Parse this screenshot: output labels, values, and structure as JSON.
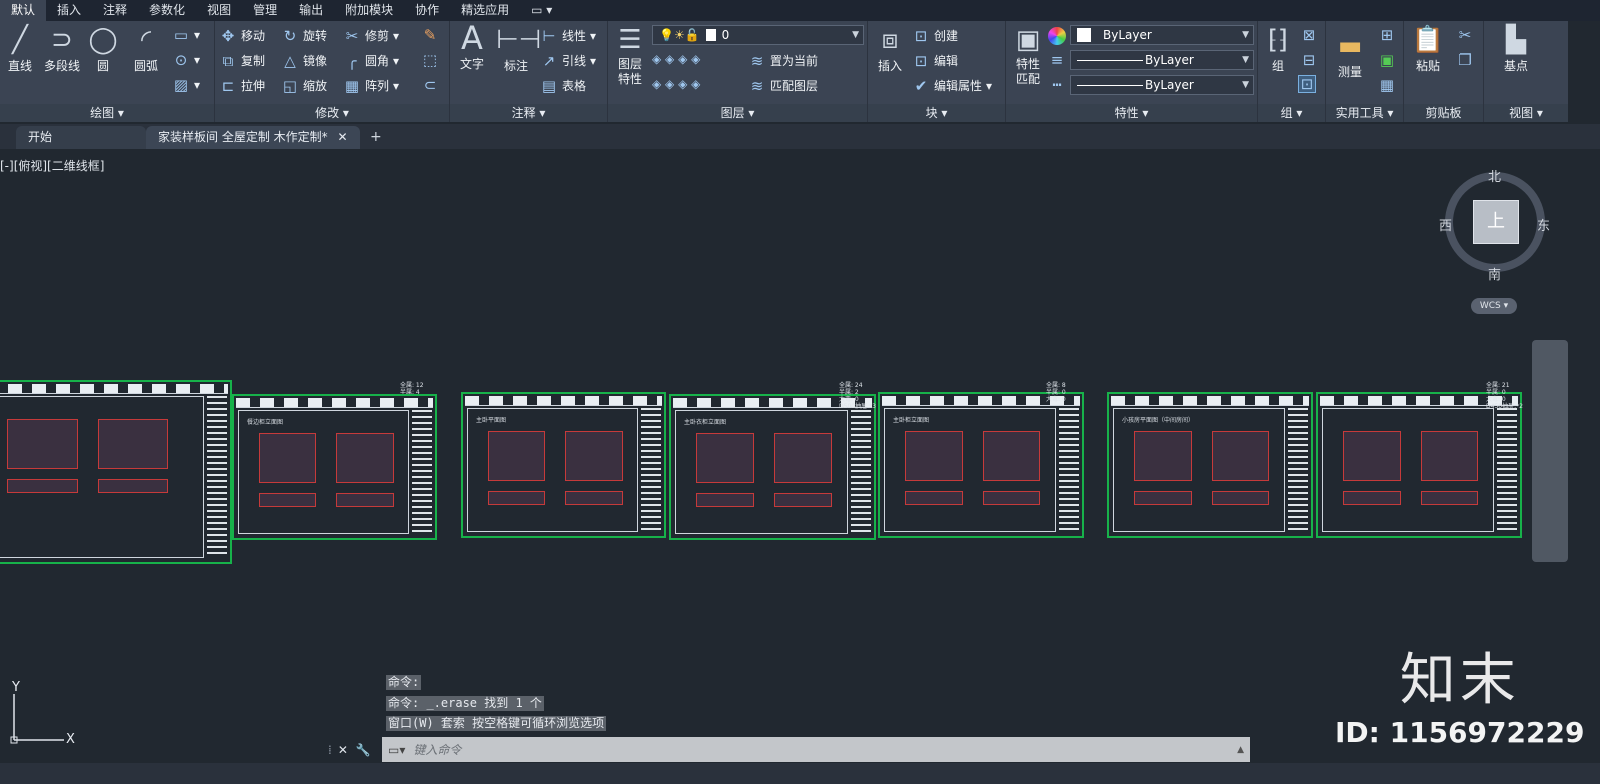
{
  "menu_tabs": [
    "默认",
    "插入",
    "注释",
    "参数化",
    "视图",
    "管理",
    "输出",
    "附加模块",
    "协作",
    "精选应用"
  ],
  "ribbon": {
    "draw": {
      "title": "绘图",
      "line": "直线",
      "polyline": "多段线",
      "circle": "圆",
      "arc": "圆弧"
    },
    "modify": {
      "title": "修改",
      "move": "移动",
      "rotate": "旋转",
      "trim": "修剪",
      "copy": "复制",
      "mirror": "镜像",
      "fillet": "圆角",
      "stretch": "拉伸",
      "scale": "缩放",
      "array": "阵列"
    },
    "annotation": {
      "title": "注释",
      "text": "文字",
      "dimension": "标注",
      "linear": "线性",
      "leader": "引线",
      "table": "表格"
    },
    "layers": {
      "title": "图层",
      "properties": "图层\n特性",
      "current_layer": "0",
      "set_current": "置为当前",
      "match_layer": "匹配图层"
    },
    "block": {
      "title": "块",
      "insert": "插入",
      "create": "创建",
      "edit": "编辑",
      "edit_attr": "编辑属性"
    },
    "properties": {
      "title": "特性",
      "match": "特性\n匹配",
      "color": "ByLayer",
      "linetype": "ByLayer",
      "lineweight": "ByLayer"
    },
    "groups": {
      "title": "组",
      "group": "组"
    },
    "utilities": {
      "title": "实用工具",
      "measure": "测量"
    },
    "clipboard": {
      "title": "剪贴板",
      "paste": "粘贴"
    },
    "view": {
      "title": "视图",
      "base_point": "基点"
    }
  },
  "doc_tabs": {
    "start": "开始",
    "active": "家装样板间 全屋定制 木作定制*"
  },
  "viewport_label": "[-][俯视][二维线框]",
  "viewcube": {
    "top": "上",
    "north": "北",
    "south": "南",
    "east": "东",
    "west": "西",
    "wcs": "WCS"
  },
  "sheets": [
    {
      "title": "",
      "stats": "全属: 12\n半属: 4\n大弯: 0\nD300抽屉:*3"
    },
    {
      "title": "餐边柜立面图",
      "stats": ""
    },
    {
      "title": "主卧平面图",
      "stats": ""
    },
    {
      "title": "主卧衣柜立面图",
      "stats": "全属: 24\n半属: 2\n大弯: 0\nD500抽屉:*3"
    },
    {
      "title": "主卧柜立面图",
      "stats": "全属: 8\n半属: 0\n大弯: 0"
    },
    {
      "title": "小孩房平面图（中间房间）",
      "stats": ""
    },
    {
      "title": "",
      "stats": "全属: 21\n半属: 0\n大弯: 0\nD450抽屉:*2"
    }
  ],
  "command_history": [
    "命令:",
    "命令: _.erase 找到 1 个",
    "窗口(W) 套索  按空格键可循环浏览选项"
  ],
  "command_input": {
    "placeholder": "键入命令"
  },
  "ucs": {
    "x": "X",
    "y": "Y"
  },
  "watermark": {
    "logo": "知末",
    "id": "ID: 1156972229"
  },
  "colors": {
    "ribbon": "#3b4453",
    "canvas": "#212830",
    "sheet_border": "#17b24a"
  }
}
